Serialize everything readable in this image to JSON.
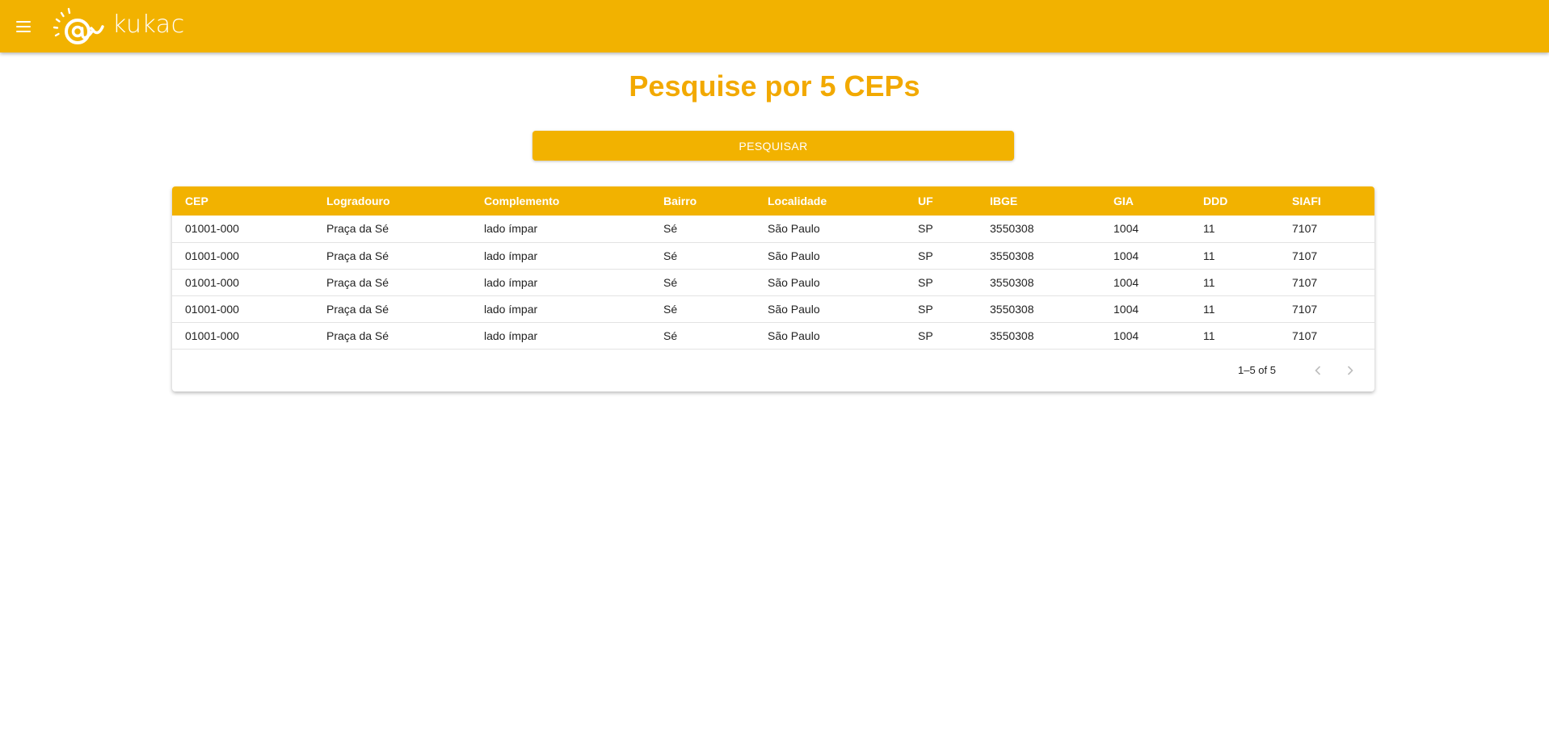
{
  "app": {
    "brand": "kukac",
    "accent": "#f2b200",
    "title_color": "#f2a900"
  },
  "header": {
    "menu_icon": "hamburger-menu-icon",
    "logo_icon": "kukac-at-snail-logo"
  },
  "main": {
    "title": "Pesquise por 5 CEPs",
    "search_button_label": "PESQUISAR"
  },
  "table": {
    "columns": [
      "CEP",
      "Logradouro",
      "Complemento",
      "Bairro",
      "Localidade",
      "UF",
      "IBGE",
      "GIA",
      "DDD",
      "SIAFI"
    ],
    "rows": [
      [
        "01001-000",
        "Praça da Sé",
        "lado ímpar",
        "Sé",
        "São Paulo",
        "SP",
        "3550308",
        "1004",
        "11",
        "7107"
      ],
      [
        "01001-000",
        "Praça da Sé",
        "lado ímpar",
        "Sé",
        "São Paulo",
        "SP",
        "3550308",
        "1004",
        "11",
        "7107"
      ],
      [
        "01001-000",
        "Praça da Sé",
        "lado ímpar",
        "Sé",
        "São Paulo",
        "SP",
        "3550308",
        "1004",
        "11",
        "7107"
      ],
      [
        "01001-000",
        "Praça da Sé",
        "lado ímpar",
        "Sé",
        "São Paulo",
        "SP",
        "3550308",
        "1004",
        "11",
        "7107"
      ],
      [
        "01001-000",
        "Praça da Sé",
        "lado ímpar",
        "Sé",
        "São Paulo",
        "SP",
        "3550308",
        "1004",
        "11",
        "7107"
      ]
    ],
    "pagination": {
      "range_text": "1–5 of 5",
      "prev_icon": "chevron-left-icon",
      "next_icon": "chevron-right-icon"
    }
  }
}
